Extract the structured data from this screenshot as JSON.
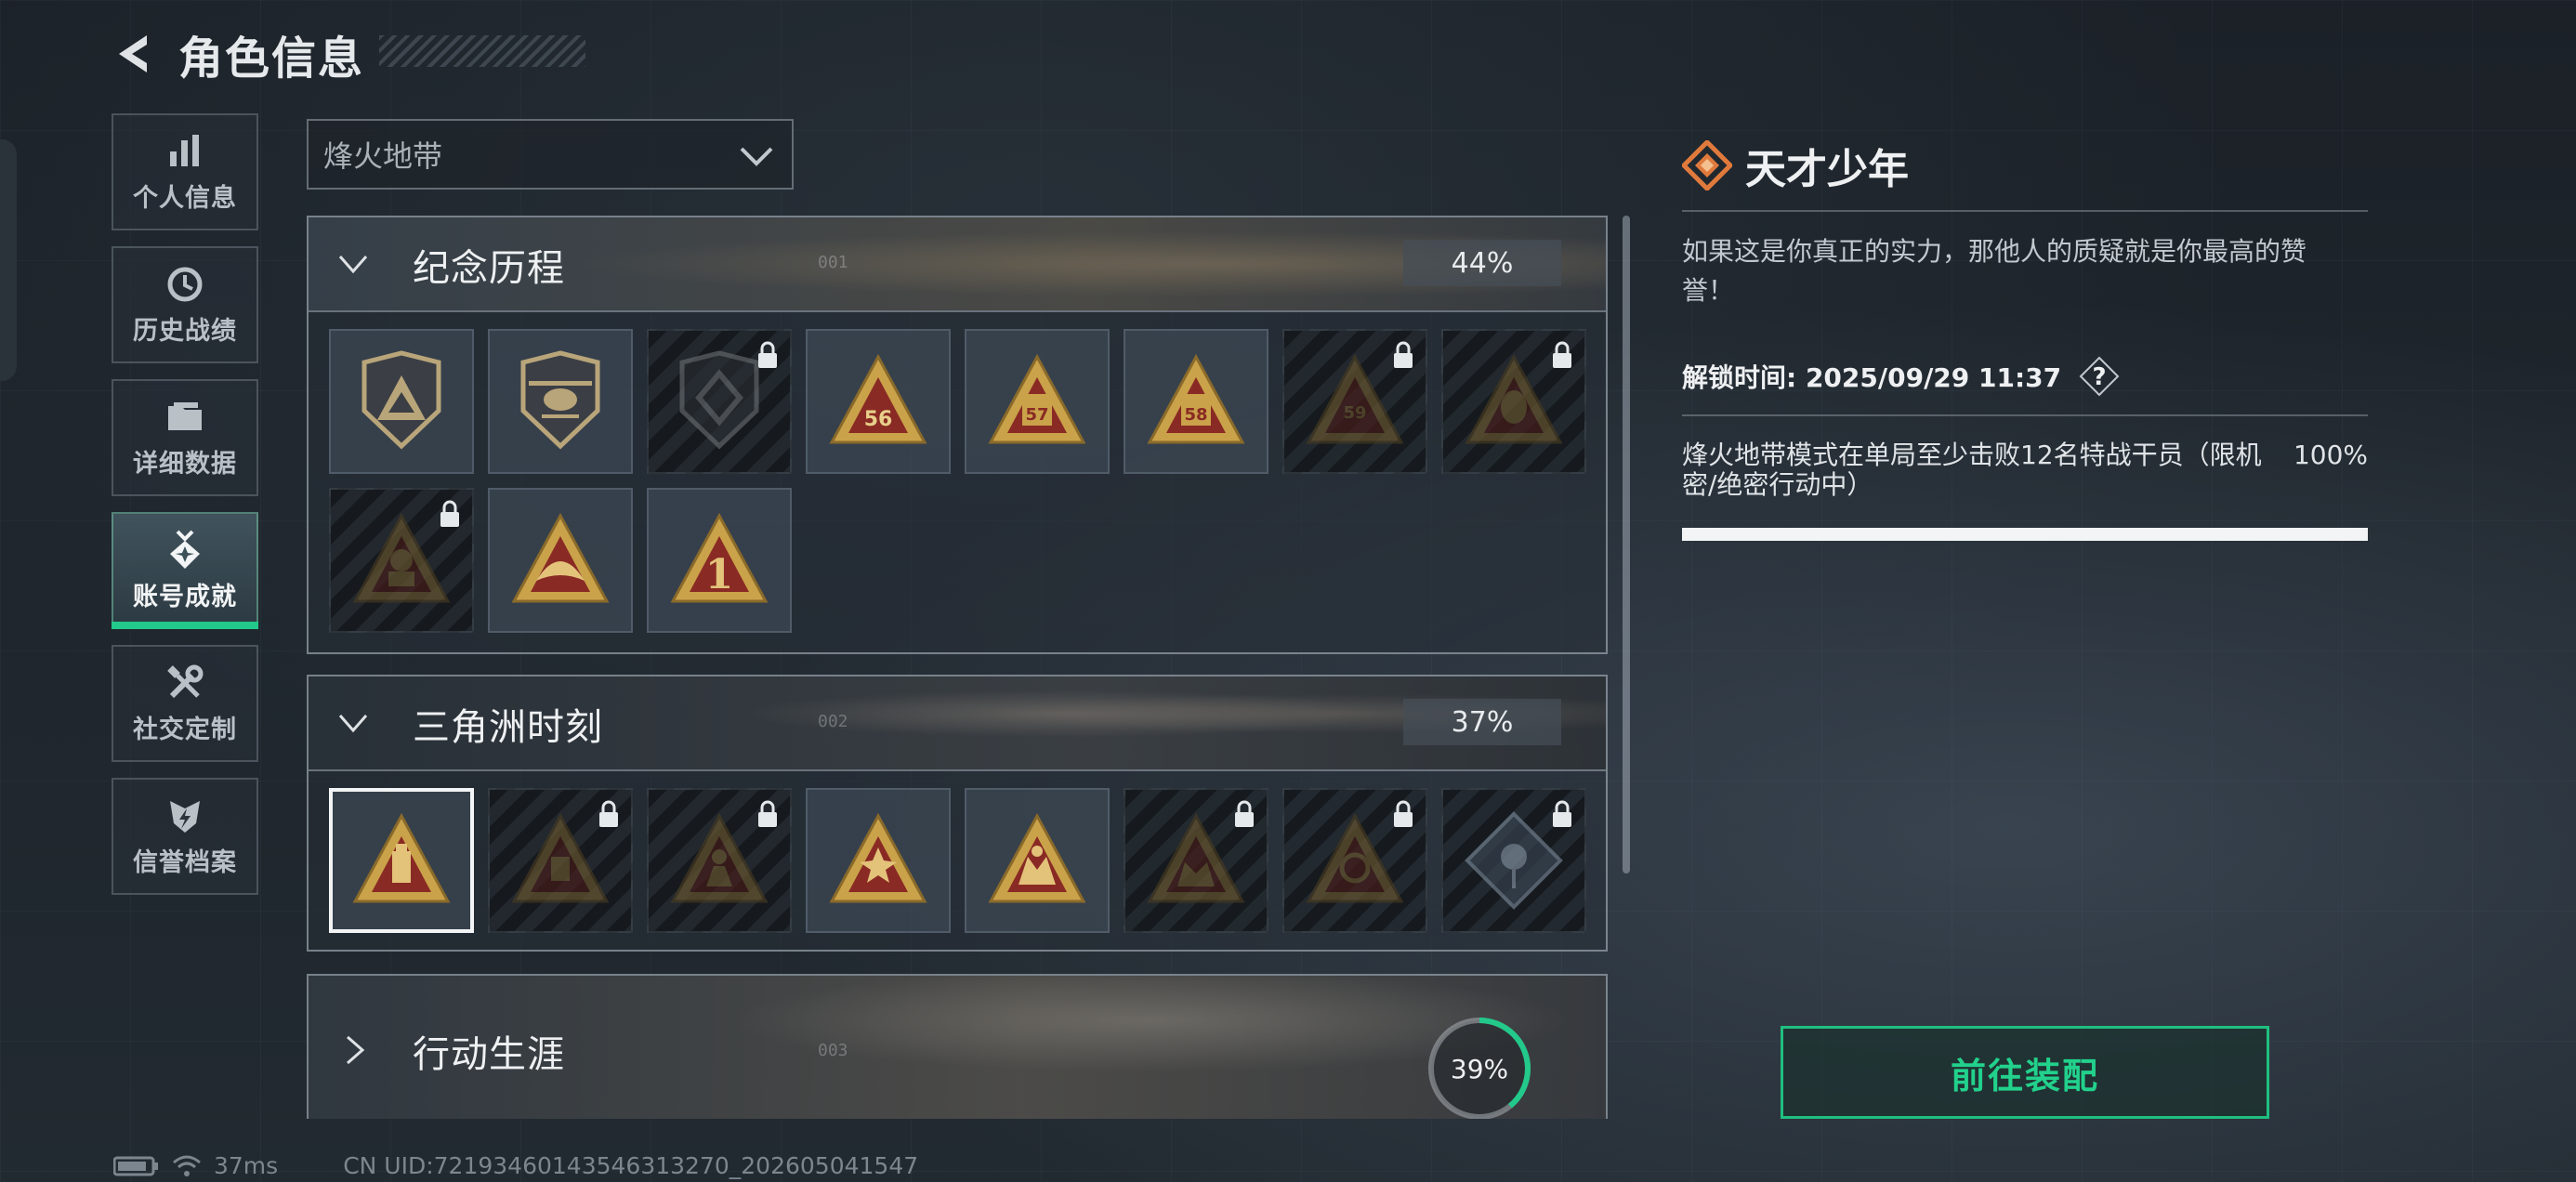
{
  "header": {
    "title": "角色信息"
  },
  "nav": {
    "items": [
      {
        "label": "个人信息",
        "icon": "bar-chart-icon",
        "active": false
      },
      {
        "label": "历史战绩",
        "icon": "history-clock-icon",
        "active": false
      },
      {
        "label": "详细数据",
        "icon": "folder-icon",
        "active": false
      },
      {
        "label": "账号成就",
        "icon": "achievement-medal-icon",
        "active": true
      },
      {
        "label": "社交定制",
        "icon": "wrench-screwdriver-icon",
        "active": false
      },
      {
        "label": "信誉档案",
        "icon": "credit-shield-icon",
        "active": false
      }
    ]
  },
  "mode_select": {
    "value": "烽火地带"
  },
  "sections": [
    {
      "title": "纪念历程",
      "index": "001",
      "progress": "44%",
      "expanded": true,
      "badges": [
        {
          "icon": "shield-triangle-emblem-icon",
          "locked": false
        },
        {
          "icon": "helicopter-shield-emblem-icon",
          "locked": false
        },
        {
          "icon": "diamond-crest-emblem-icon",
          "locked": true
        },
        {
          "icon": "number-56-triangle-emblem-icon",
          "locked": false,
          "text": "56"
        },
        {
          "icon": "number-57-triangle-emblem-icon",
          "locked": false,
          "text": "57"
        },
        {
          "icon": "number-58-triangle-emblem-icon",
          "locked": false,
          "text": "58"
        },
        {
          "icon": "number-59-triangle-emblem-icon",
          "locked": true,
          "text": "59"
        },
        {
          "icon": "mask-triangle-emblem-icon",
          "locked": true
        },
        {
          "icon": "soldier-triangle-emblem-icon",
          "locked": true
        },
        {
          "icon": "wings-triangle-emblem-icon",
          "locked": false
        },
        {
          "icon": "number-one-triangle-emblem-icon",
          "locked": false,
          "text": "1"
        }
      ]
    },
    {
      "title": "三角洲时刻",
      "index": "002",
      "progress": "37%",
      "expanded": true,
      "badges": [
        {
          "icon": "usb-triangle-emblem-icon",
          "locked": false,
          "selected": true
        },
        {
          "icon": "chip-triangle-emblem-icon",
          "locked": true
        },
        {
          "icon": "figure-triangle-emblem-icon",
          "locked": true
        },
        {
          "icon": "hands-star-triangle-emblem-icon",
          "locked": false
        },
        {
          "icon": "figures-star-triangle-emblem-icon",
          "locked": false
        },
        {
          "icon": "team-triangle-emblem-icon",
          "locked": true
        },
        {
          "icon": "hand-circle-triangle-emblem-icon",
          "locked": true
        },
        {
          "icon": "rose-diamond-emblem-icon",
          "locked": true
        }
      ]
    },
    {
      "title": "行动生涯",
      "index": "003",
      "progress": "39%",
      "progress_value": 0.39,
      "expanded": false
    }
  ],
  "detail": {
    "title": "天才少年",
    "description": "如果这是你真正的实力，那他人的质疑就是你最高的赞誉！",
    "unlock_label": "解锁时间: 2025/09/29 11:37",
    "requirement": "烽火地带模式在单局至少击败12名特战干员（限机密/绝密行动中）",
    "requirement_progress": "100%",
    "progress_value": 1.0,
    "equip_button": "前往装配"
  },
  "footer": {
    "ping": "37ms",
    "uid": "CN UID:72193460143546313270_202605041547"
  },
  "colors": {
    "accent_green": "#22c98a",
    "detail_icon_orange": "#e07a3c",
    "badge_gold": "#c9a24a",
    "badge_red": "#8a2a24"
  }
}
